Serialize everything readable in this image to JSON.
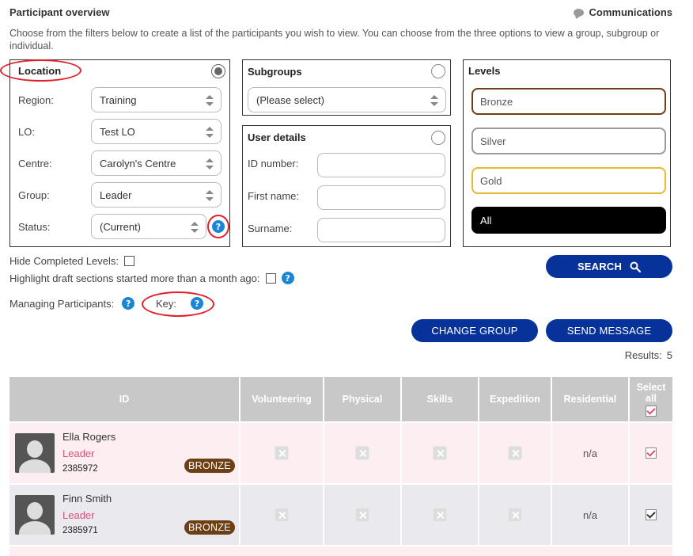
{
  "header": {
    "title": "Participant overview",
    "communications": "Communications",
    "intro": "Choose from the filters below to create a list of the participants you wish to view. You can choose from the three options to view a group, subgroup or individual."
  },
  "location": {
    "title": "Location",
    "fields": [
      {
        "label": "Region:",
        "value": "Training"
      },
      {
        "label": "LO:",
        "value": "Test LO"
      },
      {
        "label": "Centre:",
        "value": "Carolyn's Centre"
      },
      {
        "label": "Group:",
        "value": "Leader"
      },
      {
        "label": "Status:",
        "value": "(Current)"
      }
    ]
  },
  "subgroups": {
    "title": "Subgroups",
    "select": "(Please select)"
  },
  "user_details": {
    "title": "User details",
    "fields": [
      {
        "label": "ID number:",
        "value": ""
      },
      {
        "label": "First name:",
        "value": ""
      },
      {
        "label": "Surname:",
        "value": ""
      }
    ]
  },
  "levels": {
    "title": "Levels",
    "options": [
      "Bronze",
      "Silver",
      "Gold",
      "All"
    ],
    "colors": {
      "bronze": "#6e3f15",
      "silver": "#9a9a9a",
      "gold": "#e8b830",
      "all": "#000000"
    }
  },
  "options": {
    "hide_completed": "Hide Completed Levels:",
    "highlight_draft": "Highlight draft sections started more than a month ago:",
    "managing": "Managing Participants:",
    "key": "Key:"
  },
  "buttons": {
    "search": "SEARCH",
    "change_group": "CHANGE GROUP",
    "send_message": "SEND MESSAGE"
  },
  "results": {
    "label": "Results:",
    "count": "5"
  },
  "table": {
    "columns": [
      "ID",
      "Volunteering",
      "Physical",
      "Skills",
      "Expedition",
      "Residential",
      "Select all"
    ],
    "rows": [
      {
        "name": "Ella Rogers",
        "role": "Leader",
        "id": "2385972",
        "level": "BRONZE",
        "residential": "n/a",
        "selected": true
      },
      {
        "name": "Finn Smith",
        "role": "Leader",
        "id": "2385971",
        "level": "BRONZE",
        "residential": "n/a",
        "selected": true
      }
    ]
  },
  "icons": {
    "help": "?",
    "search": "search-icon",
    "chat": "chat-bubble-icon"
  },
  "accent_colors": {
    "button": "#06329a",
    "help": "#1a86d6",
    "highlight_ring": "#e0202a",
    "role": "#e0507a"
  }
}
